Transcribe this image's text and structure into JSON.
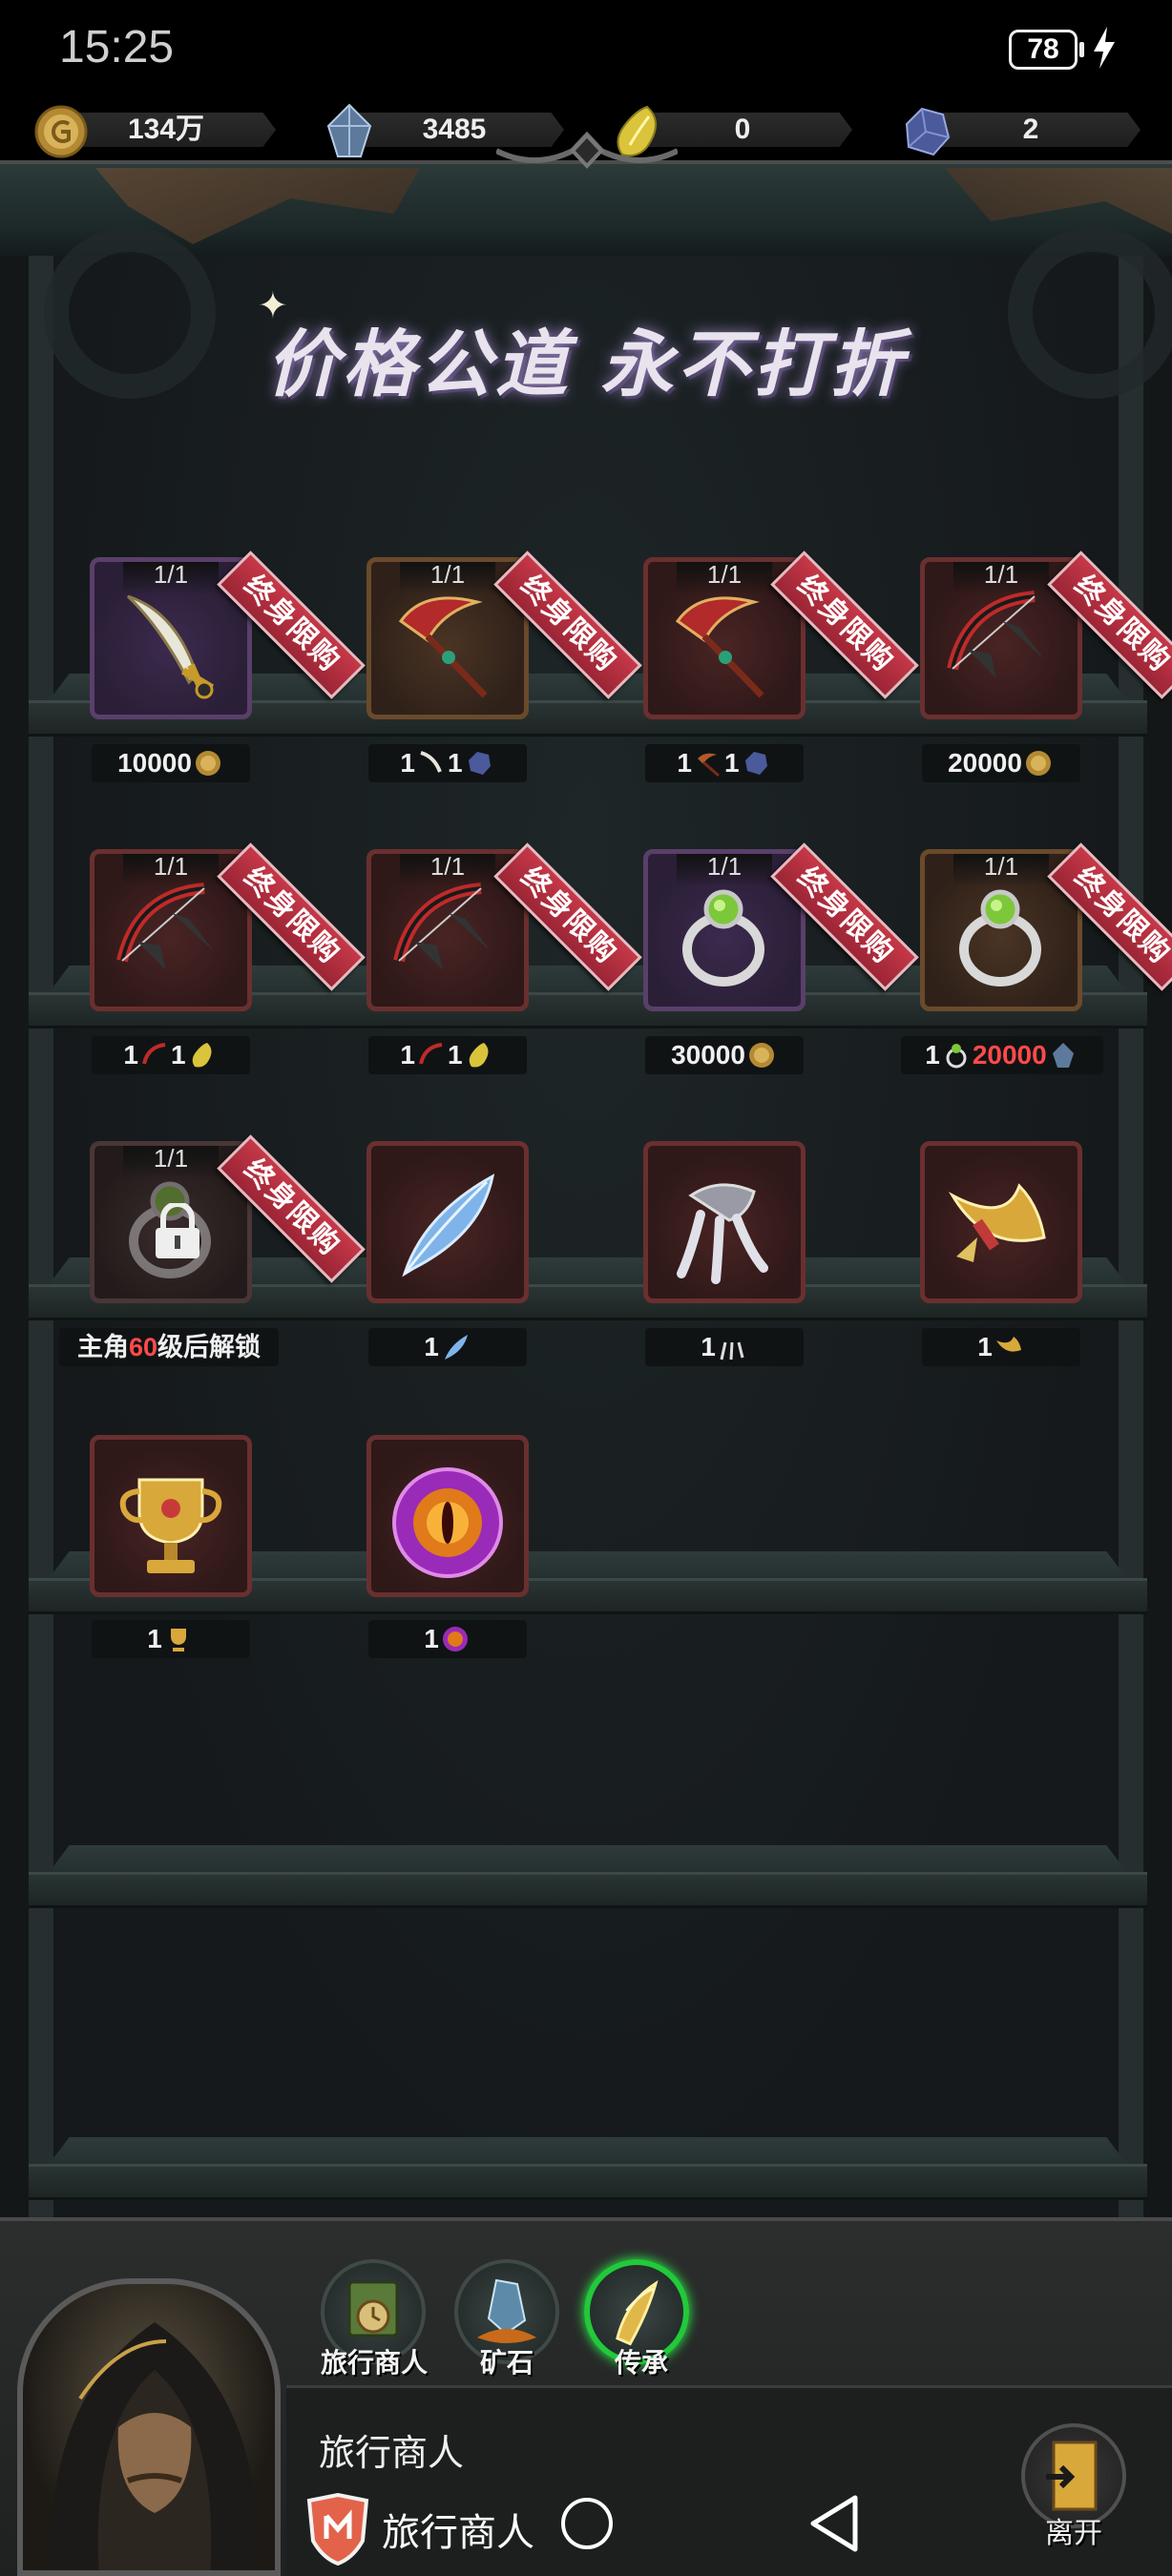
{
  "status": {
    "time": "15:25",
    "battery": "78"
  },
  "currencies": [
    {
      "name": "gold-coin",
      "value": "134万",
      "color": "#c9a34a"
    },
    {
      "name": "crystal",
      "value": "3485",
      "color": "#9fb6d4"
    },
    {
      "name": "yellow-gem",
      "value": "0",
      "color": "#e6d24a"
    },
    {
      "name": "blue-ore",
      "value": "2",
      "color": "#6f7fc0"
    }
  ],
  "banner": {
    "title_a": "价格公道",
    "title_b": "永不打折"
  },
  "ribbon_text": "终身限购",
  "items": [
    {
      "id": "curved-sword",
      "stock": "1/1",
      "ribbon": true,
      "price": "10000",
      "price_icon": "gold-coin-icon"
    },
    {
      "id": "red-scythe-a",
      "stock": "1/1",
      "ribbon": true,
      "price_a": "1",
      "price_b": "1"
    },
    {
      "id": "red-scythe-b",
      "stock": "1/1",
      "ribbon": true,
      "price_a": "1",
      "price_b": "1"
    },
    {
      "id": "black-red-bow-a",
      "stock": "1/1",
      "ribbon": true,
      "price": "20000",
      "price_icon": "gold-coin-icon"
    },
    {
      "id": "black-red-bow-b",
      "stock": "1/1",
      "ribbon": true,
      "price_a": "1",
      "price_b": "1"
    },
    {
      "id": "black-red-bow-c",
      "stock": "1/1",
      "ribbon": true,
      "price_a": "1",
      "price_b": "1"
    },
    {
      "id": "green-ring-a",
      "stock": "1/1",
      "ribbon": true,
      "price": "30000",
      "price_icon": "gold-coin-icon"
    },
    {
      "id": "green-ring-b",
      "stock": "1/1",
      "ribbon": true,
      "price_a": "1",
      "price_b": "20000"
    },
    {
      "id": "locked-ring",
      "stock": "1/1",
      "ribbon": true,
      "unlock_pre": "主角",
      "unlock_level": "60",
      "unlock_post": "级后解锁"
    },
    {
      "id": "blue-feather",
      "price": "1"
    },
    {
      "id": "silver-claw",
      "price": "1"
    },
    {
      "id": "golden-horn",
      "price": "1"
    },
    {
      "id": "golden-trophy",
      "price": "1"
    },
    {
      "id": "fire-eye-orb",
      "price": "1"
    }
  ],
  "tabs": [
    {
      "label": "旅行商人",
      "icon": "clock-scroll-icon"
    },
    {
      "label": "矿石",
      "icon": "ore-crystal-icon"
    },
    {
      "label": "传承",
      "icon": "golden-horn-icon"
    }
  ],
  "merchant": {
    "name": "旅行商人"
  },
  "leave_label": "离开",
  "nav": {
    "app_label": "旅行商人"
  }
}
